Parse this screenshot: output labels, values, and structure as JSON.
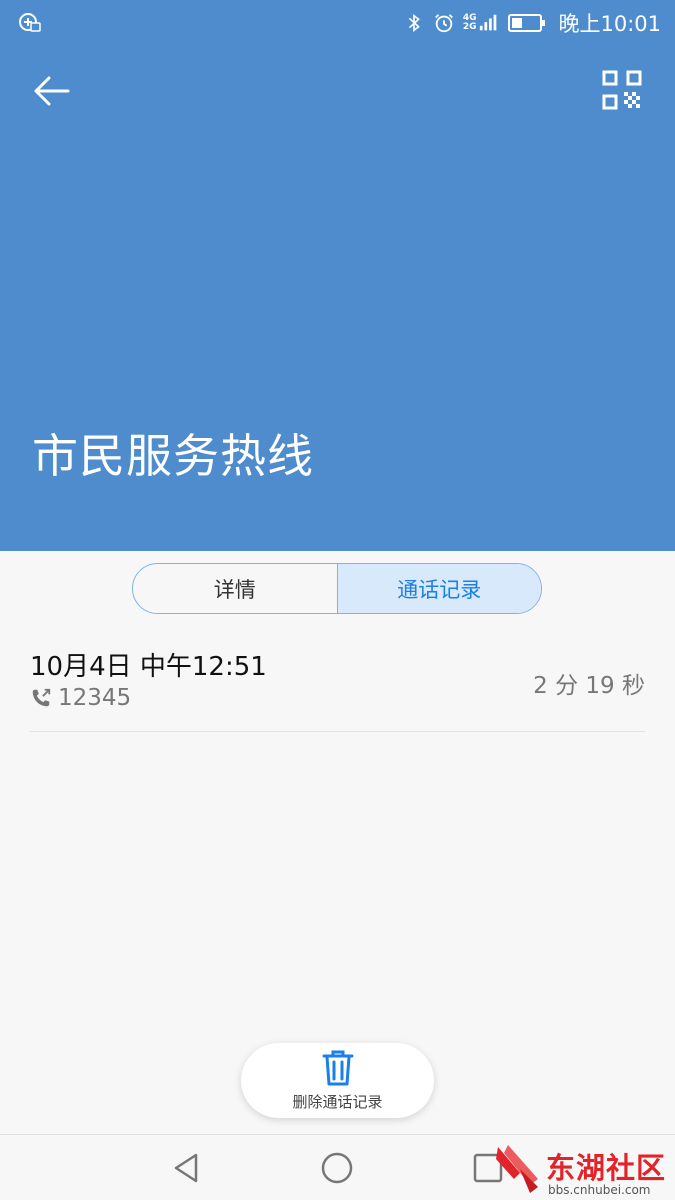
{
  "status_bar": {
    "time": "晚上10:01",
    "network_top": "4G",
    "network_bottom": "2G",
    "icons": [
      "app-notification-icon",
      "bluetooth-icon",
      "alarm-icon",
      "signal-icon",
      "battery-icon"
    ]
  },
  "header": {
    "contact_name": "市民服务热线",
    "background_color": "#4e8ccd"
  },
  "tabs": [
    {
      "label": "详情",
      "active": false
    },
    {
      "label": "通话记录",
      "active": true
    }
  ],
  "call_log": [
    {
      "datetime": "10月4日 中午12:51",
      "number": "12345",
      "duration": "2 分 19 秒"
    }
  ],
  "actions": {
    "delete_label": "删除通话记录"
  },
  "watermark": {
    "brand": "东湖社区",
    "site": "bbs.cnhubei.com"
  },
  "colors": {
    "accent": "#1a7fe6",
    "tab_active_bg": "#d8e9fb"
  }
}
